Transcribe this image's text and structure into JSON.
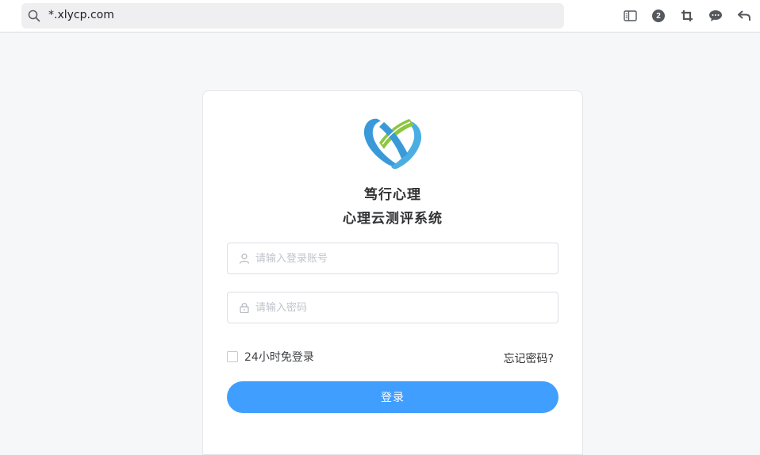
{
  "browser": {
    "url": "*.xlycp.com",
    "tab_count_badge": "2"
  },
  "icons": {
    "search": "search-icon",
    "reader": "reader-mode-icon",
    "tabs": "tab-count-icon",
    "crop": "crop-icon",
    "chat": "chat-icon",
    "back": "back-arrow-icon",
    "user": "user-icon",
    "lock": "lock-icon"
  },
  "login": {
    "brand_line1": "笃行心理",
    "brand_line2": "心理云测评系统",
    "username_placeholder": "请输入登录账号",
    "password_placeholder": "请输入密码",
    "remember_label": "24小时免登录",
    "forgot_label": "忘记密码?",
    "submit_label": "登录"
  },
  "colors": {
    "primary": "#409eff",
    "logo_blue": "#3a9ad9",
    "logo_green": "#8cc63f"
  }
}
